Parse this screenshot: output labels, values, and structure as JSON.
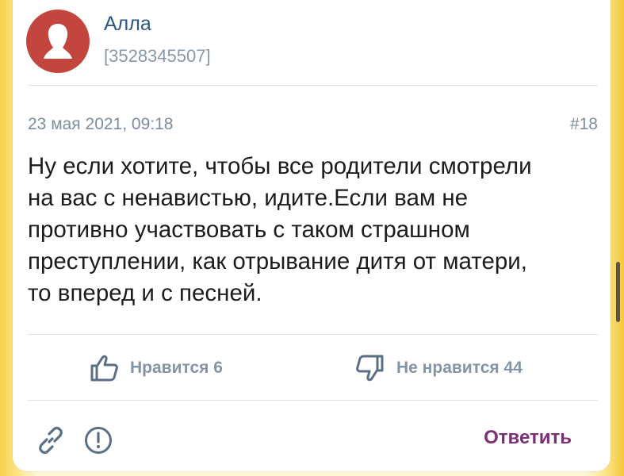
{
  "author": {
    "name": "Алла",
    "id": "[3528345507]",
    "avatar_icon": "user-silhouette-icon",
    "avatar_color": "#c2453e"
  },
  "comment": {
    "date": "23 мая 2021, 09:18",
    "number": "#18",
    "text": "Ну если хотите, чтобы все родители смотрели\nна вас с ненавистью, идите.Если вам не\nпротивно участвовать с таком страшном\nпреступлении, как отрывание дитя от матери,\nто вперед и с песней."
  },
  "reactions": {
    "like_label": "Нравится 6",
    "dislike_label": "Не нравится 44",
    "like_icon": "thumbs-up-icon",
    "dislike_icon": "thumbs-down-icon"
  },
  "actions": {
    "link_icon": "link-icon",
    "report_icon": "report-icon",
    "reply_label": "Ответить",
    "reply_color": "#7b2f74"
  }
}
